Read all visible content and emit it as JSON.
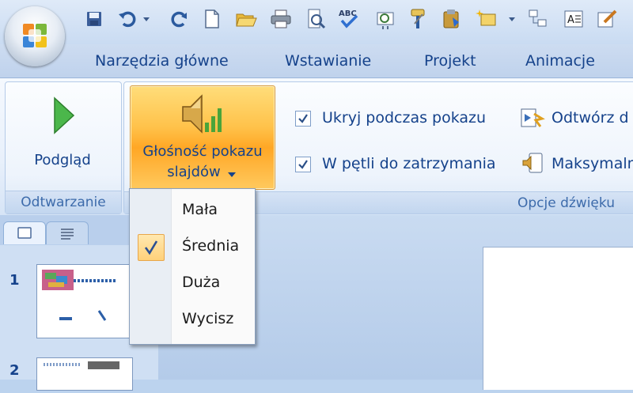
{
  "quick_access": {
    "icons": [
      "save-icon",
      "undo-icon",
      "dropdown-arrow-icon",
      "redo-icon",
      "new-document-icon",
      "open-folder-icon",
      "print-icon",
      "print-preview-icon",
      "spelling-icon",
      "research-icon",
      "format-painter-icon",
      "paste-icon",
      "new-slide-icon",
      "customize-icon",
      "outline-icon",
      "text-box-icon",
      "edit-icon"
    ]
  },
  "tabs": [
    "Narzędzia główne",
    "Wstawianie",
    "Projekt",
    "Animacje"
  ],
  "ribbon": {
    "groups": {
      "playback": {
        "label": "Odtwarzanie",
        "preview_label": "Podgląd"
      },
      "sound_options": {
        "label": "Opcje dźwięku",
        "volume_label_line1": "Głośność pokazu",
        "volume_label_line2": "slajdów",
        "hide_during_show": "Ukryj podczas pokazu",
        "loop_until_stopped": "W pętli do zatrzymania",
        "play_label": "Odtwórz d",
        "max_label": "Maksymaln"
      }
    }
  },
  "volume_menu": {
    "items": [
      {
        "label": "Mała",
        "checked": false
      },
      {
        "label": "Średnia",
        "checked": true
      },
      {
        "label": "Duża",
        "checked": false
      },
      {
        "label": "Wycisz",
        "checked": false
      }
    ]
  },
  "slides_panel": {
    "slide_numbers": [
      "1",
      "2"
    ]
  },
  "colors": {
    "ribbon_text": "#15428b",
    "group_label": "#3d6bab",
    "active_button": "#ffc24a"
  }
}
